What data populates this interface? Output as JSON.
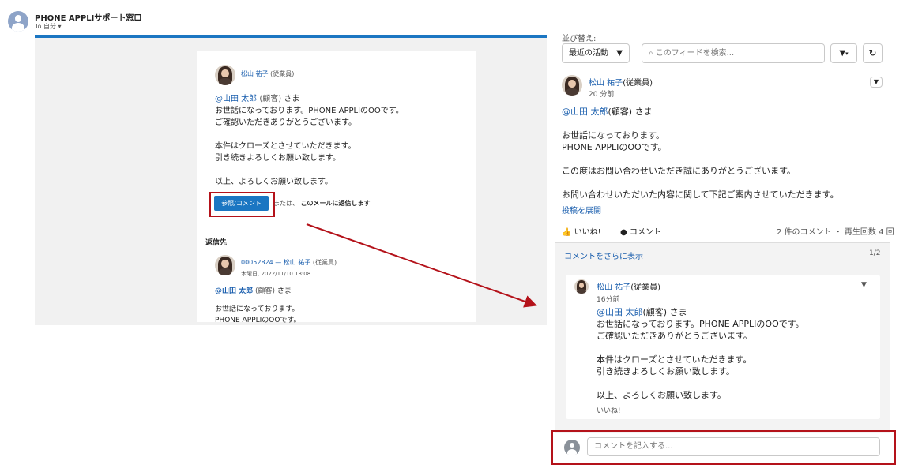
{
  "email": {
    "sender": "PHONE APPLIサポート窓口",
    "to_label": "To 自分",
    "card": {
      "author": "松山 祐子",
      "author_role": "(従業員)",
      "mention": "@山田 太郎",
      "mention_role": "(顧客)",
      "mention_suffix": "さま",
      "lines": [
        "お世話になっております。PHONE APPLIのOOです。",
        "ご確認いただきありがとうございます。",
        "",
        "本件はクローズとさせていただきます。",
        "引き続きよろしくお願い致します。",
        "",
        "以上、よろしくお願い致します。"
      ],
      "reply_button": "参照/コメント",
      "or_text": "または、",
      "reply_mail": "このメールに返信します",
      "reply_to_heading": "返信先",
      "thread_id": "00052824 — 松山 祐子",
      "thread_role": "(従業員)",
      "thread_date": "木曜日, 2022/11/10 18:08",
      "thread_mention": "@山田 太郎",
      "thread_mention_role": "(顧客)",
      "thread_suffix": "さま",
      "thread_lines": [
        "お世話になっております。",
        "PHONE APPLIのOOです。"
      ]
    }
  },
  "feed": {
    "sort_label": "並び替え:",
    "sort_value": "最近の活動",
    "search_placeholder": "このフィードを検索...",
    "post": {
      "author": "松山 祐子",
      "author_role": "(従業員)",
      "time": "20 分前",
      "mention": "@山田 太郎",
      "mention_role": "(顧客)",
      "mention_suffix": "さま",
      "lines": [
        "お世話になっております。",
        "PHONE APPLIのOOです。",
        "",
        "この度はお問い合わせいただき誠にありがとうございます。",
        "",
        "お問い合わせいただいた内容に関して下記ご案内させていただきます。"
      ],
      "expand": "投稿を展開",
      "like": "いいね!",
      "comment": "コメント",
      "stats": "2 件のコメント ・ 再生回数 4 回"
    },
    "more_comments": "コメントをさらに表示",
    "pager": "1/2",
    "comment": {
      "author": "松山 祐子",
      "author_role": "(従業員)",
      "time": "16分前",
      "mention": "@山田 太郎",
      "mention_role": "(顧客)",
      "mention_suffix": "さま",
      "lines": [
        "お世話になっております。PHONE APPLIのOOです。",
        "ご確認いただきありがとうございます。",
        "",
        "本件はクローズとさせていただきます。",
        "引き続きよろしくお願い致します。",
        "",
        "以上、よろしくお願い致します。"
      ],
      "like": "いいね!"
    },
    "comment_input_placeholder": "コメントを記入する..."
  },
  "colors": {
    "accent": "#1b76c2",
    "annotation_red": "#b4121a",
    "link": "#1b5fae"
  }
}
